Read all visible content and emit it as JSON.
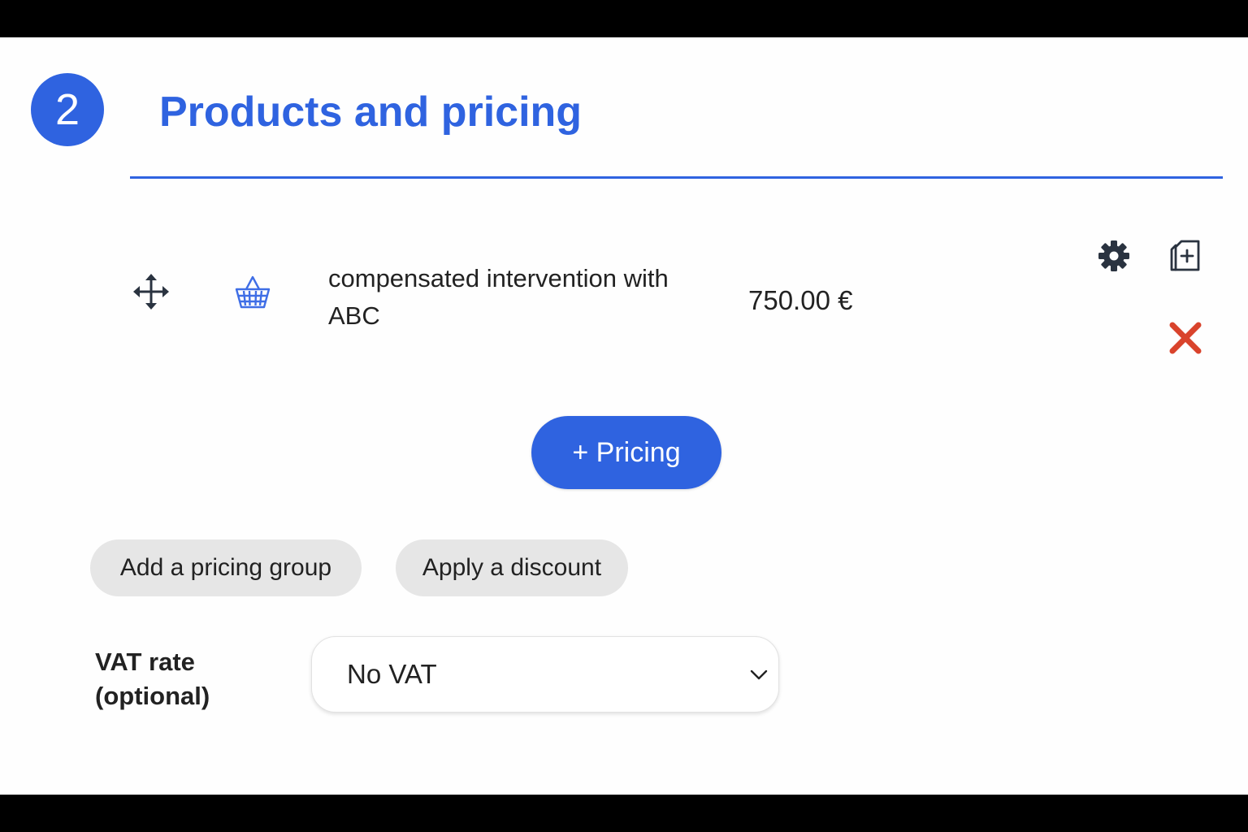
{
  "section": {
    "step_number": "2",
    "title": "Products and pricing"
  },
  "product_line": {
    "name": "compensated intervention with ABC",
    "price": "750.00 €",
    "icons": [
      "move-icon",
      "basket-icon",
      "gear-icon",
      "duplicate-icon",
      "close-icon"
    ]
  },
  "actions": {
    "add_pricing_label": "+ Pricing",
    "add_group_label": "Add a pricing group",
    "discount_label": "Apply a discount"
  },
  "vat": {
    "label": "VAT rate (optional)",
    "selected": "No VAT"
  },
  "colors": {
    "accent": "#2f63e0",
    "delete": "#d9432c",
    "icon_dark": "#2a3340"
  }
}
